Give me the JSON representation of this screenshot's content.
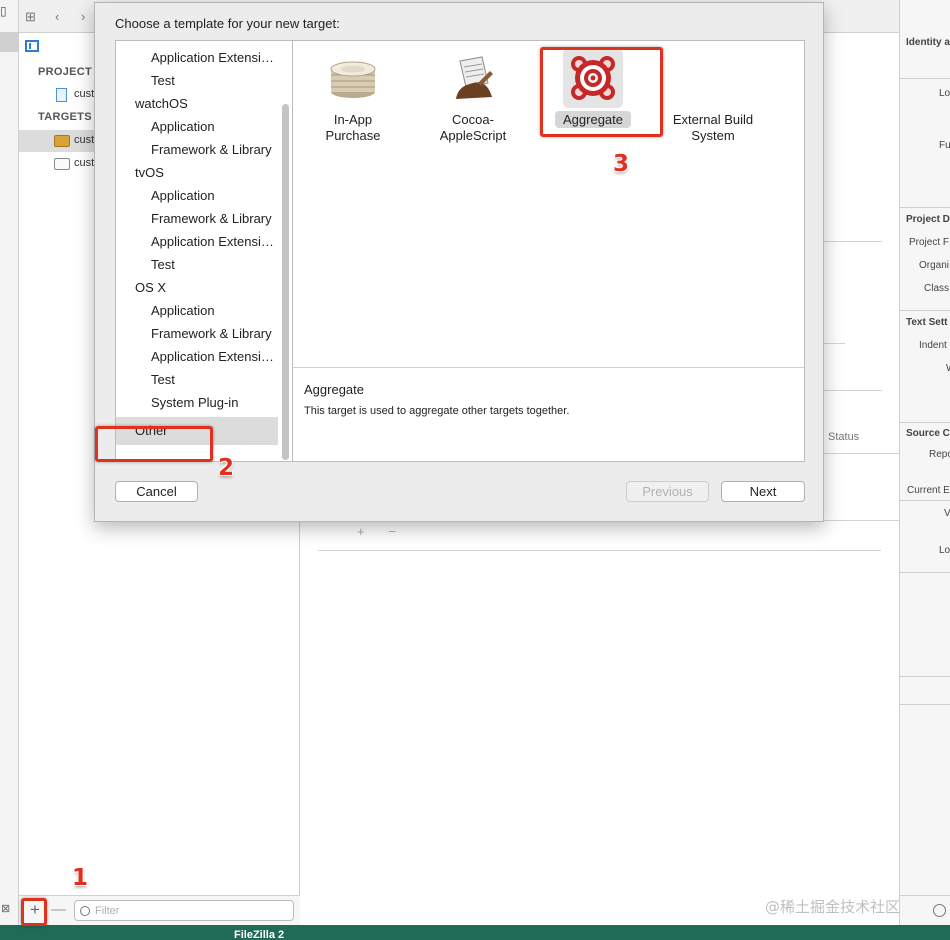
{
  "dialog": {
    "title": "Choose a template for your new target:",
    "categories": [
      {
        "label": "Application Extensi…",
        "kind": "sub"
      },
      {
        "label": "Test",
        "kind": "sub"
      },
      {
        "label": "watchOS",
        "kind": "platform"
      },
      {
        "label": "Application",
        "kind": "sub"
      },
      {
        "label": "Framework & Library",
        "kind": "sub"
      },
      {
        "label": "tvOS",
        "kind": "platform"
      },
      {
        "label": "Application",
        "kind": "sub"
      },
      {
        "label": "Framework & Library",
        "kind": "sub"
      },
      {
        "label": "Application Extensi…",
        "kind": "sub"
      },
      {
        "label": "Test",
        "kind": "sub"
      },
      {
        "label": "OS X",
        "kind": "platform"
      },
      {
        "label": "Application",
        "kind": "sub"
      },
      {
        "label": "Framework & Library",
        "kind": "sub"
      },
      {
        "label": "Application Extensi…",
        "kind": "sub"
      },
      {
        "label": "Test",
        "kind": "sub"
      },
      {
        "label": "System Plug-in",
        "kind": "sub"
      },
      {
        "label": "Other",
        "kind": "platform",
        "selected": true
      }
    ],
    "templates": [
      {
        "label": "In-App\nPurchase",
        "icon": "in-app-purchase-icon"
      },
      {
        "label": "Cocoa-\nAppleScript",
        "icon": "applescript-icon"
      },
      {
        "label": "Aggregate",
        "icon": "aggregate-target-icon",
        "selected": true
      },
      {
        "label": "External Build\nSystem",
        "icon": "external-build-icon"
      }
    ],
    "description": {
      "title": "Aggregate",
      "text": "This target is used to aggregate other targets together."
    },
    "buttons": {
      "cancel": "Cancel",
      "previous": "Previous",
      "next": "Next"
    }
  },
  "navigator": {
    "project_header": "PROJECT",
    "project_item": "cust",
    "targets_header": "TARGETS",
    "targets": [
      {
        "label": "cust",
        "icon": "briefcase-icon",
        "selected": true
      },
      {
        "label": "cust",
        "icon": "folder-icon"
      }
    ],
    "add_label": "+",
    "remove_label": "—",
    "filter_placeholder": "Filter",
    "filter_value": ""
  },
  "editor": {
    "status_header": "Status",
    "add_remove": "+ −"
  },
  "inspector": {
    "sections": [
      {
        "header": "Identity a",
        "labels": [
          "Lo",
          "Fu"
        ]
      },
      {
        "header": "Project D",
        "labels": [
          "Project F",
          "Organi",
          "Class"
        ]
      },
      {
        "header": "Text Sett",
        "labels": [
          "Indent",
          "W"
        ]
      },
      {
        "header": "Source C",
        "labels": [
          "Repo",
          "Current E",
          "V",
          "Lo"
        ]
      }
    ]
  },
  "taskbar": {
    "label": "FileZilla 2"
  },
  "annotations": {
    "step1": "1",
    "step2": "2",
    "step3": "3",
    "color": "#e0301e"
  },
  "watermark": "@稀土掘金技术社区"
}
